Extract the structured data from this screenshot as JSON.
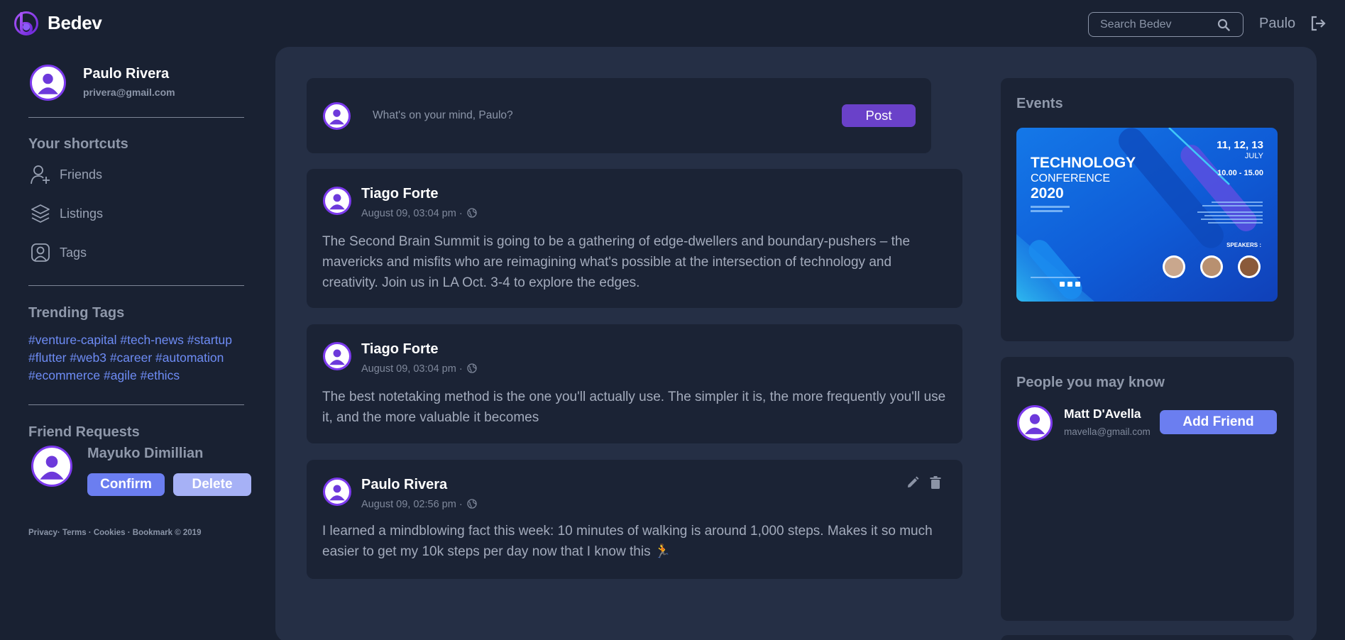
{
  "app": {
    "brand": "Bedev",
    "accent": "#7c3aed",
    "button_color": "#6b7ef0"
  },
  "header": {
    "search_placeholder": "Search Bedev",
    "username": "Paulo",
    "icons": [
      "search-icon",
      "logout-icon"
    ]
  },
  "sidebar": {
    "profile": {
      "name": "Paulo Rivera",
      "email": "privera@gmail.com"
    },
    "shortcuts_title": "Your shortcuts",
    "shortcuts": [
      {
        "label": "Friends",
        "icon": "add-friend-icon"
      },
      {
        "label": "Listings",
        "icon": "layers-icon"
      },
      {
        "label": "Tags",
        "icon": "tag-user-icon"
      }
    ],
    "trending_title": "Trending Tags",
    "tags": [
      "#venture-capital",
      "#tech-news",
      "#startup",
      "#flutter",
      "#web3",
      "#career",
      "#automation",
      "#ecommerce",
      "#agile",
      "#ethics"
    ],
    "friend_requests_title": "Friend Requests",
    "friend_request": {
      "name": "Mayuko Dimillian",
      "confirm_label": "Confirm",
      "delete_label": "Delete"
    },
    "footer": "Privacy· Terms · Cookies · Bookmark © 2019"
  },
  "composer": {
    "placeholder": "What's on your mind, Paulo?",
    "post_label": "Post"
  },
  "posts": [
    {
      "author": "Tiago Forte",
      "meta": "August 09, 03:04 pm ·",
      "text": "The Second Brain Summit is going to be a gathering of edge-dwellers and boundary-pushers – the mavericks and misfits who are reimagining what's possible at the intersection of technology and creativity. Join us in LA Oct. 3-4 to explore the edges."
    },
    {
      "author": "Tiago Forte",
      "meta": "August 09, 03:04 pm ·",
      "text": "The best notetaking method is the one you'll actually use. The simpler it is, the more frequently you'll use it, and the more valuable it becomes"
    },
    {
      "author": "Paulo Rivera",
      "meta": "August 09, 02:56 pm ·",
      "text": "I learned a mindblowing fact this week: 10 minutes of walking is around 1,000 steps. Makes it so much easier to get my 10k steps per day now that I know this 🏃"
    }
  ],
  "events": {
    "title": "Events",
    "poster": {
      "line1": "TECHNOLOGY",
      "line2": "CONFERENCE",
      "year": "2020",
      "dates": "11, 12, 13",
      "month": "JULY",
      "time": "10.00 - 15.00",
      "speakers_label": "SPEAKERS :"
    }
  },
  "people": {
    "title": "People you may know",
    "name": "Matt D'Avella",
    "email": "mavella@gmail.com",
    "add_label": "Add Friend"
  }
}
